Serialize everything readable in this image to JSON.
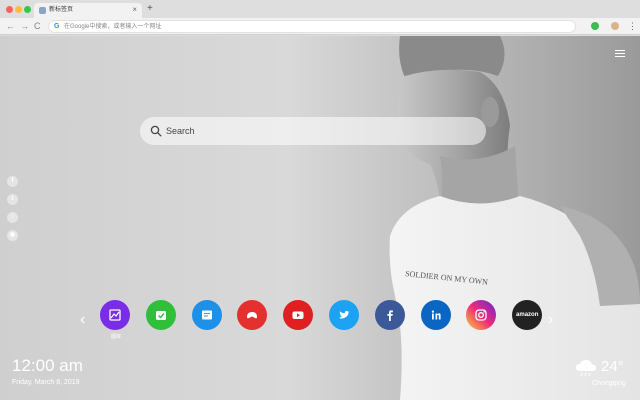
{
  "browser": {
    "tab_title": "新标签页",
    "tab_close": "×",
    "new_tab": "+",
    "nav_back": "←",
    "nav_forward": "→",
    "nav_reload": "C",
    "omnibox_placeholder": "在Google中搜索，或者输入一个网址",
    "google_letter": "G",
    "menu": "⋮"
  },
  "search": {
    "placeholder": "Search"
  },
  "social": [
    "f",
    "t",
    "♪",
    "◉"
  ],
  "apps": [
    {
      "icon": "gallery-icon",
      "color": "#7a2de6",
      "label": "图库"
    },
    {
      "icon": "check-icon",
      "color": "#2fbf3b"
    },
    {
      "icon": "note-icon",
      "color": "#1e90e8"
    },
    {
      "icon": "gamepad-icon",
      "color": "#e53030"
    },
    {
      "icon": "youtube-icon",
      "color": "#e02020"
    },
    {
      "icon": "twitter-icon",
      "color": "#1da1f2"
    },
    {
      "icon": "facebook-icon",
      "color": "#3b5998"
    },
    {
      "icon": "linkedin-icon",
      "color": "#0a66c2"
    },
    {
      "icon": "instagram-icon",
      "color": "#e1306c"
    },
    {
      "icon": "amazon-icon",
      "color": "#222222",
      "text": "amazon"
    }
  ],
  "nav": {
    "prev": "‹",
    "next": "›"
  },
  "clock": {
    "time": "12:00 am",
    "date": "Friday, March 8, 2019"
  },
  "weather": {
    "temp": "24°",
    "city": "Chongqing",
    "icon": "cloud-rain-icon"
  }
}
